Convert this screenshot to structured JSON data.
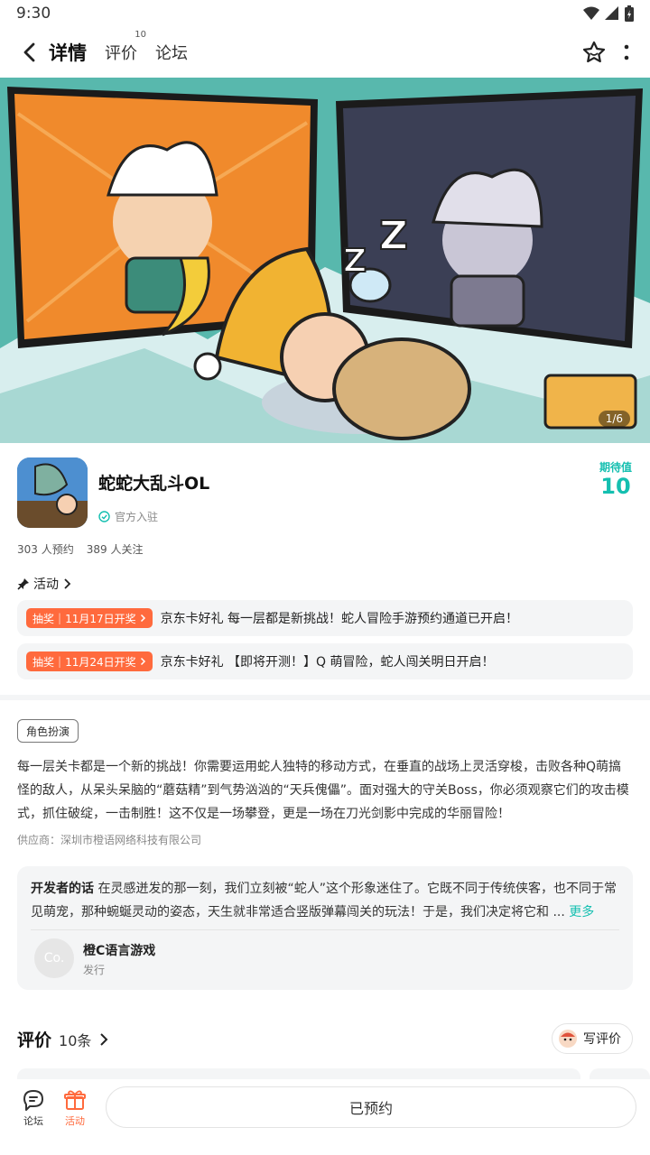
{
  "status_bar": {
    "time": "9:30"
  },
  "nav": {
    "tabs": [
      {
        "label": "详情",
        "active": true
      },
      {
        "label": "评价",
        "badge": "10"
      },
      {
        "label": "论坛"
      }
    ]
  },
  "banner": {
    "counter": "1/6"
  },
  "game": {
    "title": "蛇蛇大乱斗OL",
    "official": "官方入驻",
    "expect_label": "期待值",
    "expect_value": "10",
    "reservations": "303 人预约",
    "followers": "389 人关注"
  },
  "activities": {
    "heading": "活动",
    "items": [
      {
        "badge_type": "抽奖",
        "badge_date": "11月17日开奖",
        "text": "京东卡好礼 每一层都是新挑战！蛇人冒险手游预约通道已开启！"
      },
      {
        "badge_type": "抽奖",
        "badge_date": "11月24日开奖",
        "text": "京东卡好礼 【即将开测！】Q 萌冒险，蛇人闯关明日开启！"
      }
    ]
  },
  "detail": {
    "genre": "角色扮演",
    "description": "每一层关卡都是一个新的挑战！你需要运用蛇人独特的移动方式，在垂直的战场上灵活穿梭，击败各种Q萌搞怪的敌人，从呆头呆脑的“蘑菇精”到气势汹汹的“天兵傀儡”。面对强大的守关Boss，你必须观察它们的攻击模式，抓住破绽，一击制胜！这不仅是一场攀登，更是一场在刀光剑影中完成的华丽冒险！",
    "supplier": "供应商：深圳市橙语网络科技有限公司"
  },
  "developer": {
    "heading": "开发者的话",
    "text": "在灵感迸发的那一刻，我们立刻被“蛇人”这个形象迷住了。它既不同于传统侠客，也不同于常见萌宠，那种蜿蜒灵动的姿态，天生就非常适合竖版弹幕闯关的玩法！于是，我们决定将它和 ...",
    "more": "更多",
    "avatar_text": "Co.",
    "name": "橙C语言游戏",
    "role": "发行"
  },
  "reviews": {
    "title": "评价",
    "count": "10条",
    "write_label": "写评价"
  },
  "bottom_bar": {
    "forum_label": "论坛",
    "activity_label": "活动",
    "reserve_label": "已预约"
  },
  "colors": {
    "accent": "#14bfb0",
    "orange": "#ff6a3d"
  }
}
